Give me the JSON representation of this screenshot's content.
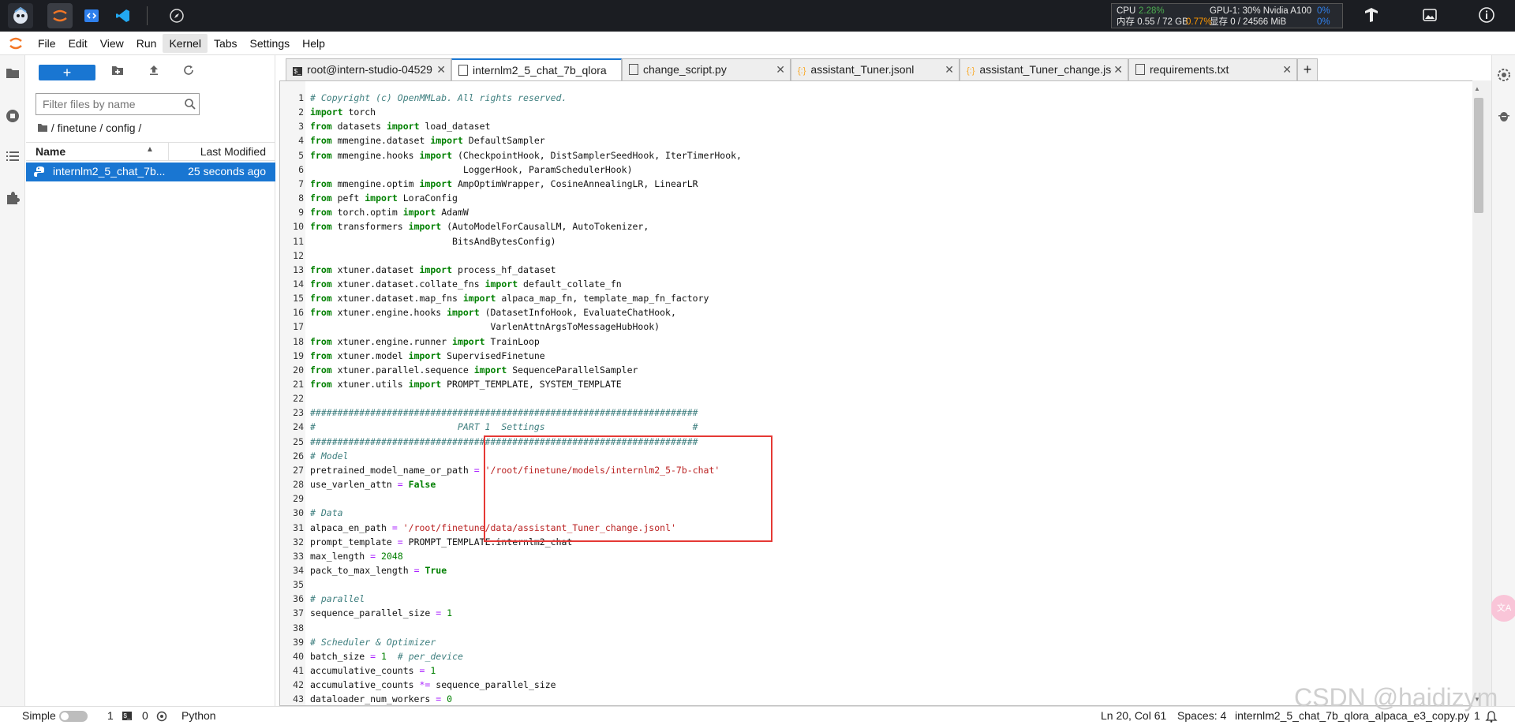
{
  "stats": {
    "cpu_label": "CPU",
    "cpu_value": "2.28%",
    "gpu_label": "GPU-1: 30% Nvidia A100",
    "gpu_value": "0%",
    "mem_label": "内存 0.55 / 72 GB",
    "mem_value": "0.77%",
    "vram_label": "显存 0 / 24566 MiB",
    "vram_value": "0%"
  },
  "menu": [
    "File",
    "Edit",
    "View",
    "Run",
    "Kernel",
    "Tabs",
    "Settings",
    "Help"
  ],
  "filebrowser": {
    "new_label": "+",
    "filter_placeholder": "Filter files by name",
    "breadcrumb": "/ finetune / config /",
    "col_name": "Name",
    "col_modified": "Last Modified",
    "file_name": "internlm2_5_chat_7b...",
    "file_modified": "25 seconds ago"
  },
  "tabs": [
    {
      "label": "root@intern-studio-04529"
    },
    {
      "label": "internlm2_5_chat_7b_qlora"
    },
    {
      "label": "change_script.py"
    },
    {
      "label": "assistant_Tuner.jsonl"
    },
    {
      "label": "assistant_Tuner_change.jsc"
    },
    {
      "label": "requirements.txt"
    }
  ],
  "code_lines": [
    "# Copyright (c) OpenMMLab. All rights reserved.",
    "import torch",
    "from datasets import load_dataset",
    "from mmengine.dataset import DefaultSampler",
    "from mmengine.hooks import (CheckpointHook, DistSamplerSeedHook, IterTimerHook,",
    "                            LoggerHook, ParamSchedulerHook)",
    "from mmengine.optim import AmpOptimWrapper, CosineAnnealingLR, LinearLR",
    "from peft import LoraConfig",
    "from torch.optim import AdamW",
    "from transformers import (AutoModelForCausalLM, AutoTokenizer,",
    "                          BitsAndBytesConfig)",
    "",
    "from xtuner.dataset import process_hf_dataset",
    "from xtuner.dataset.collate_fns import default_collate_fn",
    "from xtuner.dataset.map_fns import alpaca_map_fn, template_map_fn_factory",
    "from xtuner.engine.hooks import (DatasetInfoHook, EvaluateChatHook,",
    "                                 VarlenAttnArgsToMessageHubHook)",
    "from xtuner.engine.runner import TrainLoop",
    "from xtuner.model import SupervisedFinetune",
    "from xtuner.parallel.sequence import SequenceParallelSampler",
    "from xtuner.utils import PROMPT_TEMPLATE, SYSTEM_TEMPLATE",
    "",
    "#######################################################################",
    "#                          PART 1  Settings                           #",
    "#######################################################################",
    "# Model",
    "pretrained_model_name_or_path = '/root/finetune/models/internlm2_5-7b-chat'",
    "use_varlen_attn = False",
    "",
    "# Data",
    "alpaca_en_path = '/root/finetune/data/assistant_Tuner_change.jsonl'",
    "prompt_template = PROMPT_TEMPLATE.internlm2_chat",
    "max_length = 2048",
    "pack_to_max_length = True",
    "",
    "# parallel",
    "sequence_parallel_size = 1",
    "",
    "# Scheduler & Optimizer",
    "batch_size = 1  # per_device",
    "accumulative_counts = 1",
    "accumulative_counts *= sequence_parallel_size",
    "dataloader_num_workers = 0"
  ],
  "status": {
    "mode": "Simple",
    "count1": "1",
    "count2": "0",
    "kernel": "Python",
    "position": "Ln 20, Col 61",
    "spaces": "Spaces: 4",
    "filename": "internlm2_5_chat_7b_qlora_alpaca_e3_copy.py",
    "line_count": "1"
  },
  "watermark": "CSDN @haidizym"
}
